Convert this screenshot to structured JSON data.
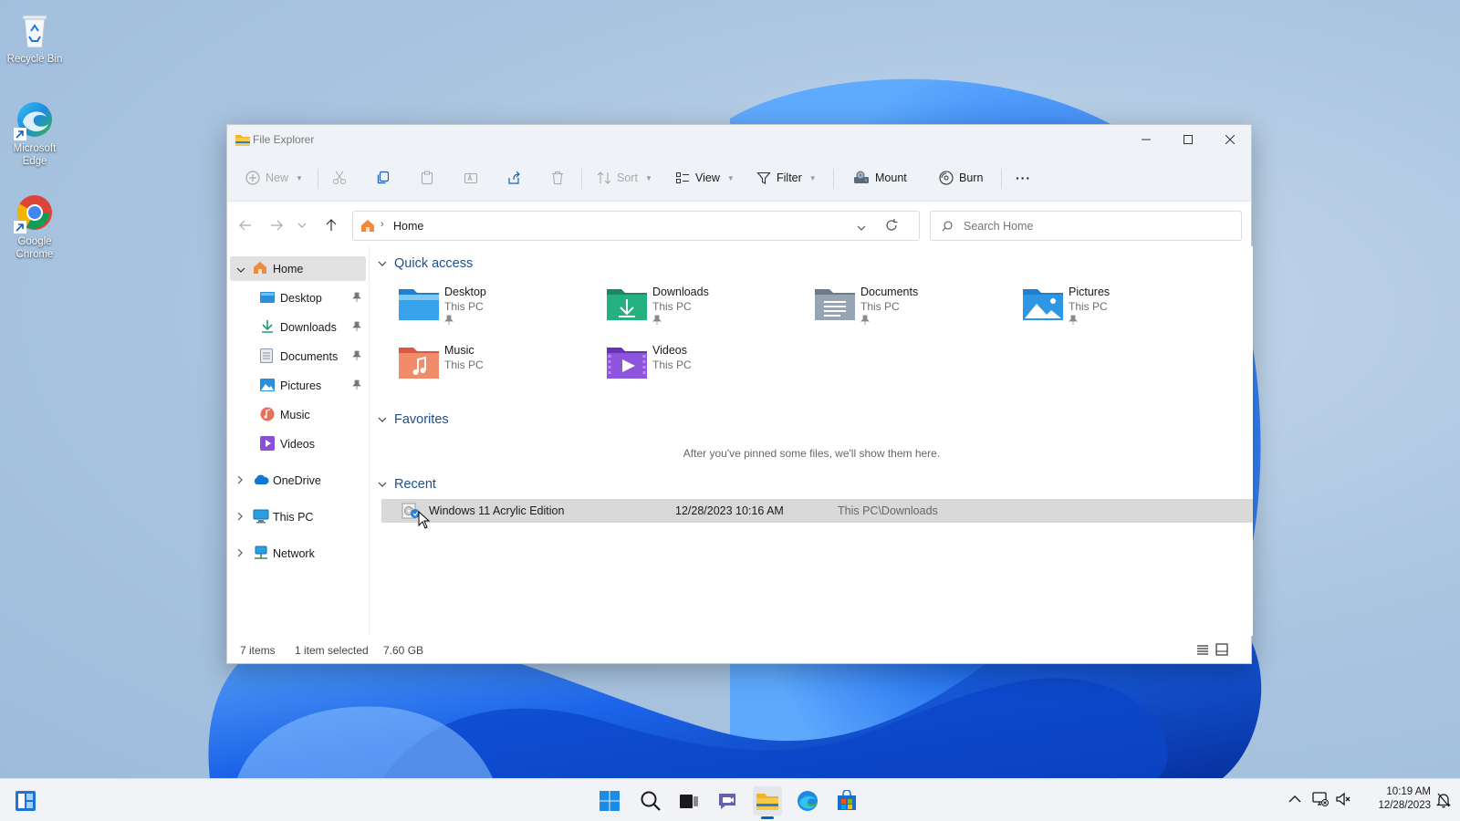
{
  "desktop": {
    "icons": [
      {
        "label": "Recycle Bin"
      },
      {
        "label": "Microsoft Edge"
      },
      {
        "label": "Google Chrome"
      }
    ]
  },
  "window": {
    "title": "File Explorer",
    "commandbar": {
      "new_label": "New",
      "sort_label": "Sort",
      "view_label": "View",
      "filter_label": "Filter",
      "mount_label": "Mount",
      "burn_label": "Burn",
      "more_label": "···"
    },
    "address": {
      "location": "Home",
      "search_placeholder": "Search Home"
    },
    "nav": {
      "home": "Home",
      "pinned": [
        {
          "label": "Desktop"
        },
        {
          "label": "Downloads"
        },
        {
          "label": "Documents"
        },
        {
          "label": "Pictures"
        },
        {
          "label": "Music"
        },
        {
          "label": "Videos"
        }
      ],
      "onedrive": "OneDrive",
      "thispc": "This PC",
      "network": "Network"
    },
    "quick_access": {
      "title": "Quick access",
      "items": [
        {
          "name": "Desktop",
          "location": "This PC"
        },
        {
          "name": "Downloads",
          "location": "This PC"
        },
        {
          "name": "Documents",
          "location": "This PC"
        },
        {
          "name": "Pictures",
          "location": "This PC"
        },
        {
          "name": "Music",
          "location": "This PC"
        },
        {
          "name": "Videos",
          "location": "This PC"
        }
      ]
    },
    "favorites": {
      "title": "Favorites",
      "empty_message": "After you've pinned some files, we'll show them here."
    },
    "recent": {
      "title": "Recent",
      "items": [
        {
          "name": "Windows 11 Acrylic Edition",
          "date": "12/28/2023 10:16 AM",
          "location": "This PC\\Downloads"
        }
      ]
    },
    "status": {
      "item_count": "7 items",
      "selection": "1 item selected",
      "size": "7.60 GB"
    }
  },
  "taskbar": {
    "time": "10:19 AM",
    "date": "12/28/2023"
  },
  "colors": {
    "accent": "#0067c0",
    "selection": "#d9d9d9",
    "section_heading": "#1d4f8c"
  }
}
